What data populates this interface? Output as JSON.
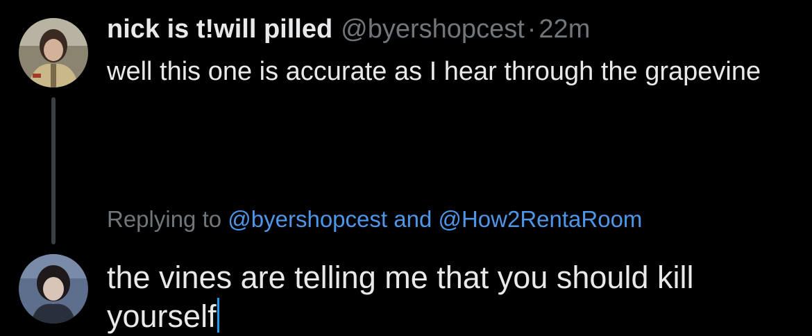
{
  "tweet": {
    "display_name": "nick is t!will pilled",
    "handle": "@byershopcest",
    "separator": "·",
    "timestamp": "22m",
    "text": "well this one is accurate as I hear through the grapevine",
    "avatar_icon": "user-avatar-icon"
  },
  "reply": {
    "prefix": "Replying to",
    "mention_1": "@byershopcest",
    "conjunction": "and",
    "mention_2": "@How2RentaRoom",
    "draft_text": "the vines are telling me that you should kill yourself",
    "avatar_icon": "user-avatar-icon"
  },
  "colors": {
    "background": "#000000",
    "primary_text": "#e7e9ea",
    "secondary_text": "#71767b",
    "link": "#4d96e8",
    "caret": "#1d9bf0"
  }
}
